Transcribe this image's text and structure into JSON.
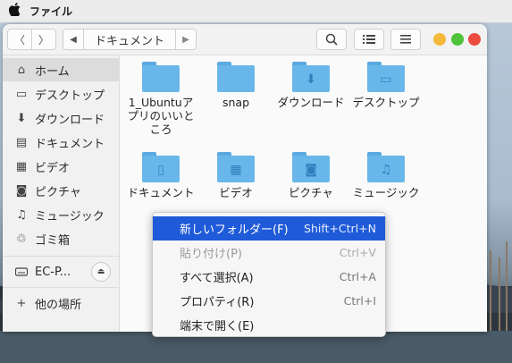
{
  "menubar": {
    "app_name": "ファイル",
    "apple_icon": "apple-icon"
  },
  "header": {
    "back_icon": "〈",
    "forward_icon": "〉",
    "path_left_icon": "◀",
    "path_right_icon": "▶",
    "breadcrumb": "ドキュメント",
    "search_icon": "⌕",
    "list_icon": "☷",
    "menu_icon": "☰"
  },
  "sidebar": {
    "items": [
      {
        "label": "ホーム",
        "icon": "⌂",
        "active": true
      },
      {
        "label": "デスクトップ",
        "icon": "▭"
      },
      {
        "label": "ダウンロード",
        "icon": "⬇"
      },
      {
        "label": "ドキュメント",
        "icon": "▤"
      },
      {
        "label": "ビデオ",
        "icon": "▦"
      },
      {
        "label": "ピクチャ",
        "icon": "◙"
      },
      {
        "label": "ミュージック",
        "icon": "♫"
      },
      {
        "label": "ゴミ箱",
        "icon": "♲"
      }
    ],
    "device": {
      "label": "EC-P...",
      "eject_icon": "⏏"
    },
    "other_places": {
      "label": "他の場所",
      "icon": "+"
    }
  },
  "folders": [
    {
      "label": "1_Ubuntuアプリのいいところ",
      "glyph": ""
    },
    {
      "label": "snap",
      "glyph": ""
    },
    {
      "label": "ダウンロード",
      "glyph": "⬇"
    },
    {
      "label": "デスクトップ",
      "glyph": "▭"
    },
    {
      "label": "ドキュメント",
      "glyph": "▯"
    },
    {
      "label": "ビデオ",
      "glyph": "▦"
    },
    {
      "label": "ピクチャ",
      "glyph": "◙"
    },
    {
      "label": "ミュージック",
      "glyph": "♫"
    }
  ],
  "context_menu": {
    "items": [
      {
        "label": "新しいフォルダー(F)",
        "shortcut": "Shift+Ctrl+N",
        "state": "highlighted"
      },
      {
        "label": "貼り付け(P)",
        "shortcut": "Ctrl+V",
        "state": "disabled"
      },
      {
        "label": "すべて選択(A)",
        "shortcut": "Ctrl+A",
        "state": "normal"
      },
      {
        "label": "プロパティ(R)",
        "shortcut": "Ctrl+I",
        "state": "normal"
      },
      {
        "label": "端末で開く(E)",
        "shortcut": "",
        "state": "normal"
      }
    ]
  },
  "colors": {
    "accent": "#1f5ad8",
    "folder": "#69b7ea",
    "close": "#ec4b3f",
    "minimize": "#f5b93a",
    "maximize": "#4fc339"
  }
}
